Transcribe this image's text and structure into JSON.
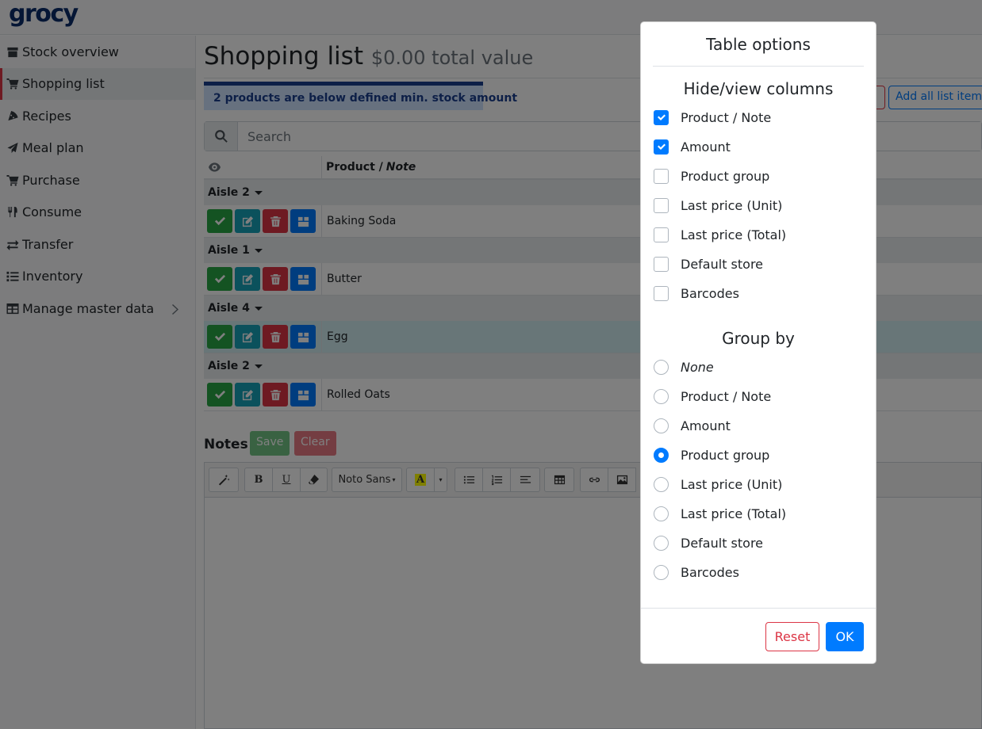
{
  "app": {
    "logo": "grocy"
  },
  "sidebar": {
    "items": [
      {
        "label": "Stock overview",
        "icon": "box-icon"
      },
      {
        "label": "Shopping list",
        "icon": "cart-icon",
        "active": true
      },
      {
        "label": "Recipes",
        "icon": "pizza-icon"
      },
      {
        "label": "Meal plan",
        "icon": "paper-plane-icon"
      },
      {
        "label": "Purchase",
        "icon": "cart-plus-icon"
      },
      {
        "label": "Consume",
        "icon": "utensils-icon"
      },
      {
        "label": "Transfer",
        "icon": "exchange-icon"
      },
      {
        "label": "Inventory",
        "icon": "list-icon"
      },
      {
        "label": "Manage master data",
        "icon": "table-icon"
      }
    ]
  },
  "page": {
    "title": "Shopping list",
    "subtitle": "$0.00 total value",
    "alert": "2 products are below defined min. stock amount",
    "add_all_button": "Add all list items"
  },
  "search": {
    "placeholder": "Search"
  },
  "table": {
    "col_product": "Product /",
    "col_note": "Note",
    "groups": [
      {
        "name": "Aisle 2",
        "items": [
          "Baking Soda"
        ]
      },
      {
        "name": "Aisle 1",
        "items": [
          "Butter"
        ]
      },
      {
        "name": "Aisle 4",
        "items": [
          "Egg"
        ]
      },
      {
        "name": "Aisle 2",
        "items": [
          "Rolled Oats"
        ]
      }
    ]
  },
  "notes": {
    "label": "Notes",
    "save": "Save",
    "clear": "Clear",
    "font_select": "Noto Sans"
  },
  "modal": {
    "title": "Table options",
    "hide_view_title": "Hide/view columns",
    "columns": [
      {
        "label": "Product / Note",
        "checked": true
      },
      {
        "label": "Amount",
        "checked": true
      },
      {
        "label": "Product group",
        "checked": false
      },
      {
        "label": "Last price (Unit)",
        "checked": false
      },
      {
        "label": "Last price (Total)",
        "checked": false
      },
      {
        "label": "Default store",
        "checked": false
      },
      {
        "label": "Barcodes",
        "checked": false
      }
    ],
    "group_by_title": "Group by",
    "group_by": [
      {
        "label": "None",
        "selected": false
      },
      {
        "label": "Product / Note",
        "selected": false
      },
      {
        "label": "Amount",
        "selected": false
      },
      {
        "label": "Product group",
        "selected": true
      },
      {
        "label": "Last price (Unit)",
        "selected": false
      },
      {
        "label": "Last price (Total)",
        "selected": false
      },
      {
        "label": "Default store",
        "selected": false
      },
      {
        "label": "Barcodes",
        "selected": false
      }
    ],
    "reset": "Reset",
    "ok": "OK"
  }
}
